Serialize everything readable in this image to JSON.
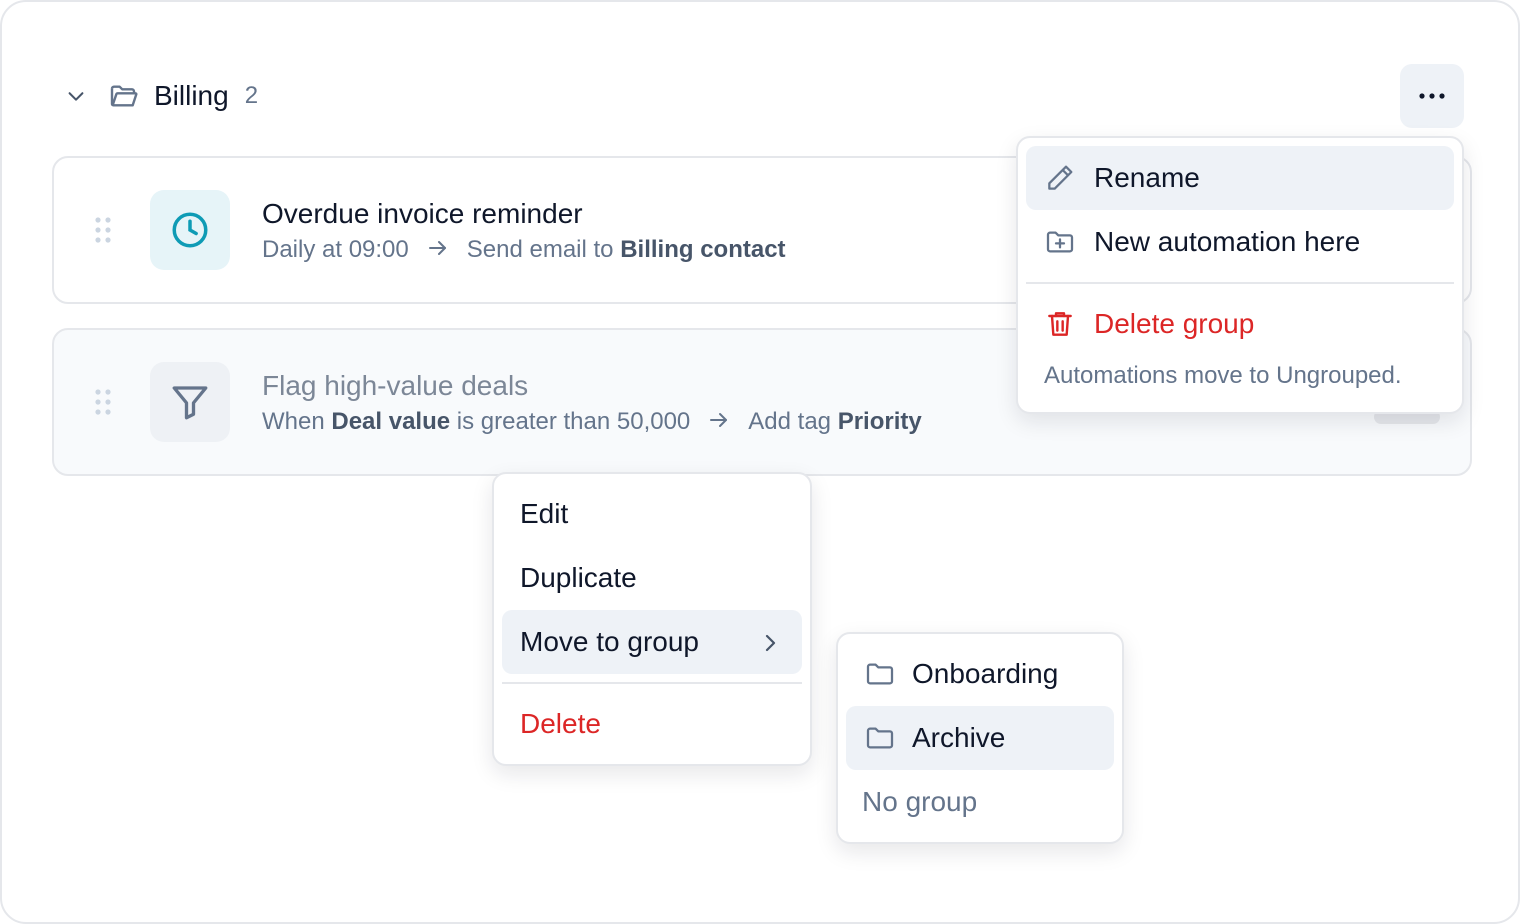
{
  "group": {
    "title": "Billing",
    "count": "2"
  },
  "automations": [
    {
      "title": "Overdue invoice reminder",
      "trigger": "Daily at 09:00",
      "action_prefix": "Send email to",
      "action_target": "Billing contact",
      "icon": "clock-icon",
      "enabled": true
    },
    {
      "title": "Flag high-value deals",
      "trigger_prefix": "When",
      "trigger_field": "Deal value",
      "trigger_rest": "is greater than 50,000",
      "action_prefix": "Add tag",
      "action_target": "Priority",
      "icon": "filter-icon",
      "enabled": false
    }
  ],
  "group_menu": {
    "rename": "Rename",
    "new_automation": "New automation here",
    "delete_group": "Delete group",
    "note": "Automations move to Ungrouped."
  },
  "item_menu": {
    "edit": "Edit",
    "duplicate": "Duplicate",
    "move_to_group": "Move to group",
    "delete": "Delete"
  },
  "move_submenu": {
    "options": [
      "Onboarding",
      "Archive"
    ],
    "none": "No group"
  },
  "colors": {
    "accent_teal": "#0e9bb5",
    "danger": "#dc2626",
    "highlight": "#eef2f7"
  }
}
